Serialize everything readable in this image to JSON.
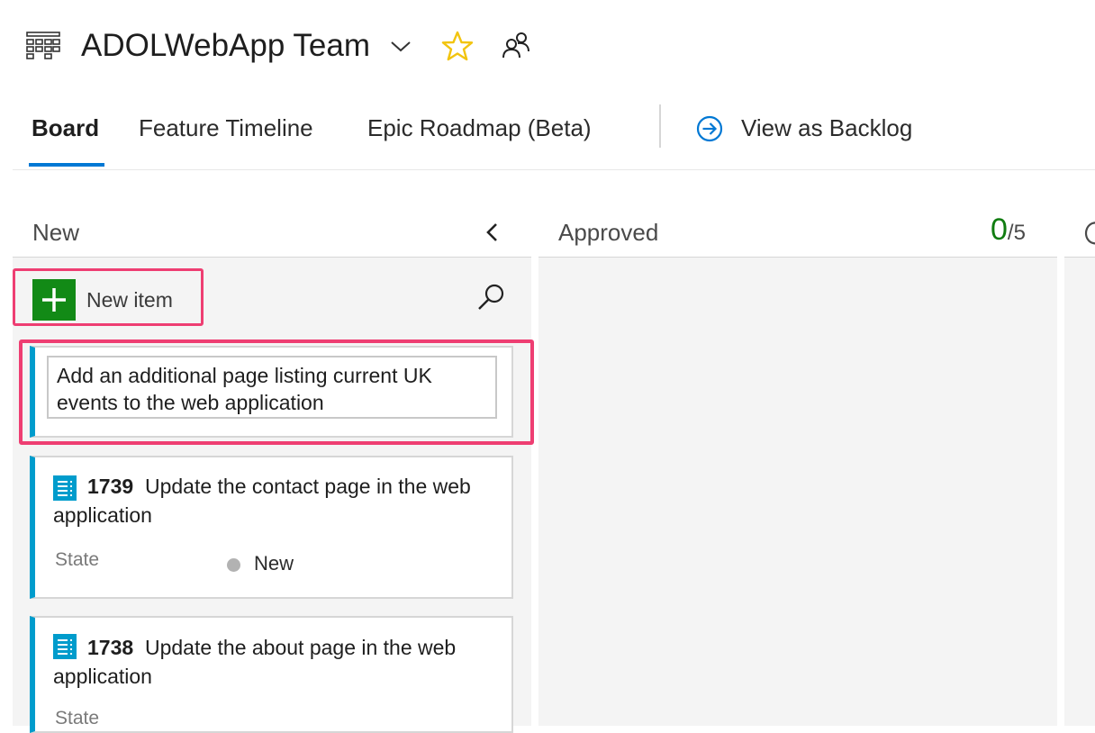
{
  "header": {
    "team_name": "ADOLWebApp Team"
  },
  "tabs": [
    {
      "label": "Board",
      "active": true
    },
    {
      "label": "Feature Timeline",
      "active": false
    },
    {
      "label": "Epic Roadmap (Beta)",
      "active": false
    }
  ],
  "view_as_backlog": "View as Backlog",
  "columns": [
    {
      "title": "New"
    },
    {
      "title": "Approved",
      "wip_current": "0",
      "wip_limit": "/5"
    }
  ],
  "new_item_label": "New item",
  "editing_card": {
    "title_value": "Add an additional page listing current UK events to the web application"
  },
  "cards": [
    {
      "id": "1739",
      "title": "Update the contact page in the web application",
      "state_label": "State",
      "state": "New"
    },
    {
      "id": "1738",
      "title": "Update the about page in the web application",
      "state_label": "State"
    }
  ],
  "colors": {
    "accent": "#0078d4",
    "add_button": "#128a16",
    "card_stripe": "#009ccc",
    "highlight": "#ee3e72",
    "wip_ok": "#107c10",
    "star": "#f2c40f"
  }
}
